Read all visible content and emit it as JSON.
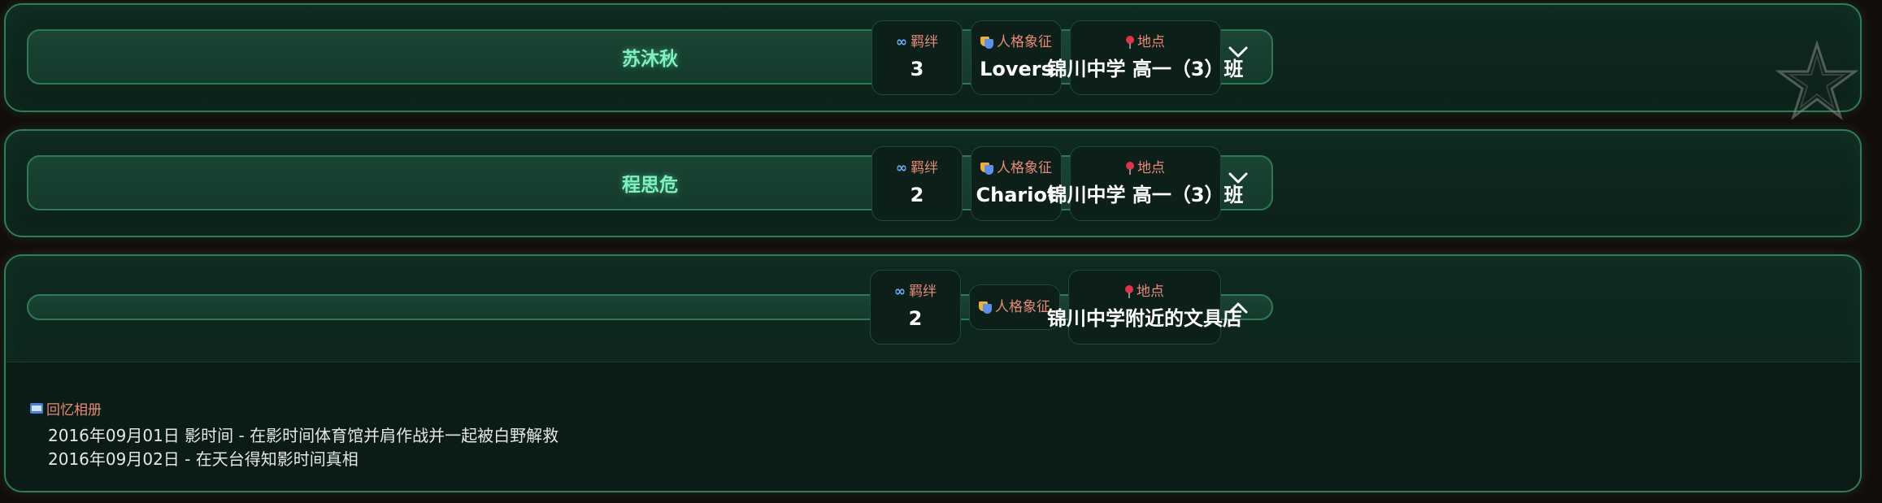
{
  "labels": {
    "bond": "羁绊",
    "persona": "人格象征",
    "location": "地点",
    "album": "回忆相册"
  },
  "cards": [
    {
      "name": "苏沐秋",
      "bond": "3",
      "persona": "Lovers",
      "location": "锦川中学 高一（3）班",
      "expanded": false
    },
    {
      "name": "程思危",
      "bond": "2",
      "persona": "Chariot",
      "location": "锦川中学 高一（3）班",
      "expanded": false
    },
    {
      "name": "",
      "bond": "2",
      "persona": "",
      "location": "锦川中学附近的文具店",
      "expanded": true,
      "album": [
        "2016年09月01日 影时间 - 在影时间体育馆并肩作战并一起被白野解救",
        "2016年09月02日 - 在天台得知影时间真相"
      ]
    }
  ],
  "icons": {
    "bond": "infinity-icon",
    "persona": "theater-masks-icon",
    "location": "pushpin-icon",
    "album": "film-icon",
    "collapsed": "chevron-down-icon",
    "expanded": "chevron-up-icon"
  },
  "colors": {
    "accent": "#7ff0c0",
    "border": "#2f7d58",
    "label": "#e98a77",
    "background": "#130d0b"
  }
}
